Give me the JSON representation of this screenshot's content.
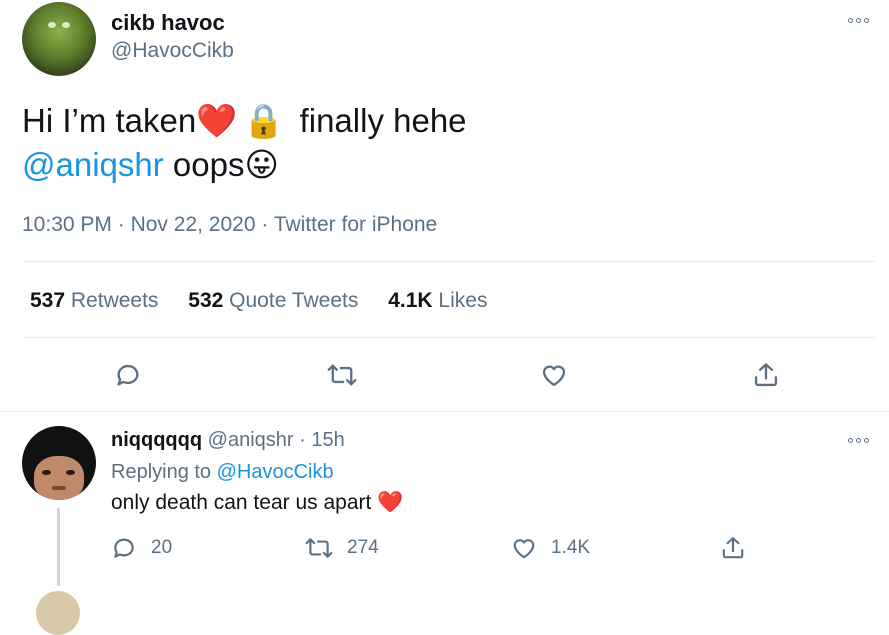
{
  "tweet": {
    "author_name": "cikb havoc",
    "author_handle": "@HavocCikb",
    "line1_text": "Hi I’m taken",
    "line1_tail": "finally hehe",
    "line2_mention": "@aniqshr",
    "line2_text": "oops",
    "emoji_heart": "❤️",
    "emoji_lock": "🔒",
    "emoji_tongue": "😛",
    "time": "10:30 PM",
    "date": "Nov 22, 2020",
    "source": "Twitter for iPhone",
    "separator": "·",
    "stats": {
      "retweets_count": "537",
      "retweets_label": "Retweets",
      "quotes_count": "532",
      "quotes_label": "Quote Tweets",
      "likes_count": "4.1K",
      "likes_label": "Likes"
    }
  },
  "reply": {
    "author_name": "niqqqqqq",
    "author_handle": "@aniqshr",
    "separator": "·",
    "age": "15h",
    "replying_prefix": "Replying to",
    "replying_handle": "@HavocCikb",
    "text": "only death can tear us apart",
    "emoji_heart": "❤️",
    "reply_count": "20",
    "retweet_count": "274",
    "like_count": "1.4K"
  },
  "icons": {
    "more": "more-icon",
    "reply": "reply-icon",
    "retweet": "retweet-icon",
    "like": "like-icon",
    "share": "share-icon"
  },
  "colors": {
    "link": "#1b95e0",
    "secondary_text": "#5b7083",
    "divider": "#e6ecf0",
    "thread_line": "#ccd6dd"
  }
}
